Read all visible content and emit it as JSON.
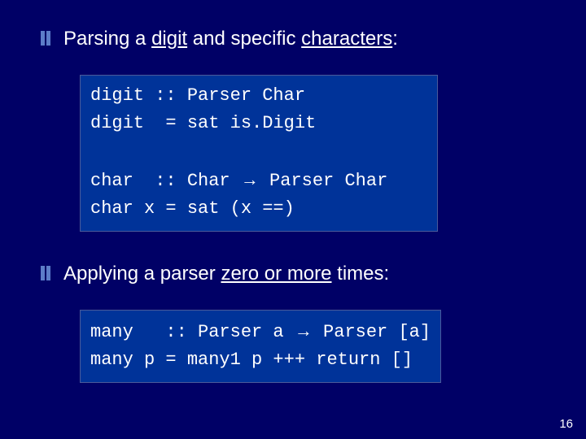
{
  "bullets": [
    {
      "pre": "Parsing a ",
      "u1": "digit",
      "mid": " and specific ",
      "u2": "characters",
      "post": ":"
    },
    {
      "pre": "Applying a parser ",
      "u1": "zero or more",
      "mid": " times:",
      "u2": "",
      "post": ""
    }
  ],
  "code1": {
    "l1a": "digit :: Parser Char",
    "l2a": "digit  = sat is.Digit",
    "blank": " ",
    "l3a": "char  :: Char ",
    "l3b": " Parser Char",
    "l4a": "char x = sat (x ==)"
  },
  "code2": {
    "l1a": "many   :: Parser a ",
    "l1b": " Parser [a]",
    "l2a": "many p = many1 p +++ return []"
  },
  "arrow": "→",
  "page": "16"
}
